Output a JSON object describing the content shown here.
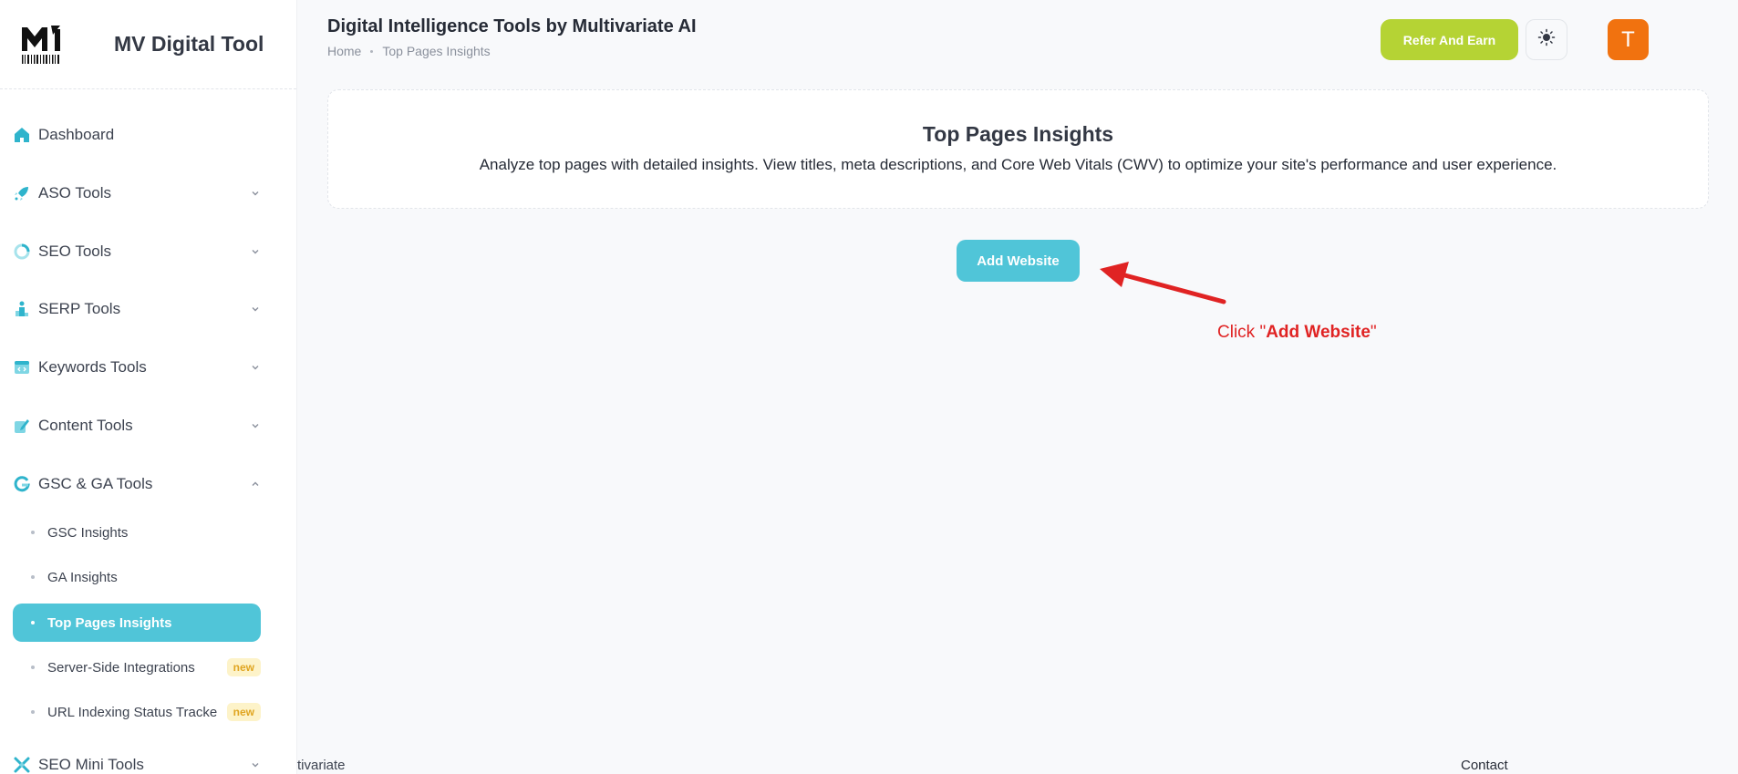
{
  "app": {
    "name": "MV Digital Tool"
  },
  "sidebar": {
    "items": [
      {
        "label": "Dashboard",
        "icon": "home-icon"
      },
      {
        "label": "ASO Tools",
        "icon": "rocket-icon"
      },
      {
        "label": "SEO Tools",
        "icon": "donut-chart-icon"
      },
      {
        "label": "SERP Tools",
        "icon": "podium-icon"
      },
      {
        "label": "Keywords Tools",
        "icon": "browser-code-icon"
      },
      {
        "label": "Content Tools",
        "icon": "edit-note-icon"
      },
      {
        "label": "GSC & GA Tools",
        "icon": "google-icon"
      },
      {
        "label": "SEO Mini Tools",
        "icon": "tools-cross-icon"
      }
    ],
    "sub_items": [
      {
        "label": "GSC Insights"
      },
      {
        "label": "GA Insights"
      },
      {
        "label": "Top Pages Insights",
        "active": true
      },
      {
        "label": "Server-Side Integrations",
        "badge": "new"
      },
      {
        "label": "URL Indexing Status Tracke",
        "badge": "new"
      }
    ]
  },
  "header": {
    "title": "Digital Intelligence Tools by Multivariate AI",
    "breadcrumb": [
      "Home",
      "Top Pages Insights"
    ],
    "refer_label": "Refer And Earn",
    "avatar_initial": "T"
  },
  "main": {
    "title": "Top Pages Insights",
    "description": "Analyze top pages with detailed insights. View titles, meta descriptions, and Core Web Vitals (CWV) to optimize your site's performance and user experience.",
    "add_website_label": "Add Website",
    "annotation_prefix": "Click \"",
    "annotation_bold": "Add Website",
    "annotation_suffix": "\""
  },
  "footer": {
    "left_text": "tivariate",
    "right_text": "Contact"
  },
  "colors": {
    "accent": "#50c5d8",
    "refer": "#b5d334",
    "avatar": "#f1720f",
    "annotation": "#e02323",
    "badge_bg": "#fdf3c9",
    "badge_text": "#e0a521"
  }
}
